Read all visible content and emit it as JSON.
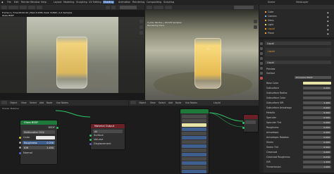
{
  "topbar": {
    "menus": [
      "File",
      "Edit",
      "Render",
      "Window",
      "Help"
    ],
    "workspaces": [
      "Layout",
      "Modeling",
      "Sculpting",
      "UV Editing",
      "Texture Paint",
      "Shading",
      "Animation",
      "Rendering",
      "Compositing",
      "Scripting"
    ],
    "scene": "Scene",
    "view_layer": "ViewLayer"
  },
  "viewport_left": {
    "info_line1": "Frame:1 | Time:00:00.00 | Mem:6.83M, Peak: 8.89M | 1/1 Samples",
    "info_line2": "Glass BSDF"
  },
  "viewport_right": {
    "info_line1": "Cycles Render | 10/128 Samples",
    "info_line2": "Rendering Done"
  },
  "node_editor_left": {
    "header": [
      "Object",
      "View",
      "Select",
      "Add",
      "Node",
      "Use Nodes"
    ],
    "material_name": "Shader Material",
    "glass_node": {
      "title": "Glass BSDF",
      "output": "BSDF",
      "distribution": "Multiscatter GGX",
      "color_label": "Color",
      "roughness_label": "Roughness",
      "roughness_value": "0.056",
      "ior_label": "IOR",
      "ior_value": "1.450",
      "normal_label": "Normal"
    },
    "output_node": {
      "title": "Material Output",
      "target": "All",
      "surface": "Surface",
      "volume": "Volume",
      "displacement": "Displacement"
    }
  },
  "node_editor_right": {
    "header": [
      "Object",
      "View",
      "Select",
      "Add",
      "Node",
      "Use Nodes"
    ],
    "material_name": "Liquid"
  },
  "outliner": {
    "items": [
      "Cube",
      "Camera",
      "Glass",
      "Light",
      "Liquid",
      "Plane"
    ]
  },
  "properties": {
    "material": "Liquid",
    "sections": [
      "Preview",
      "Surface"
    ],
    "surface_shader": "Principled BSDF",
    "rows": [
      {
        "label": "Base Color",
        "value": ""
      },
      {
        "label": "Subsurface",
        "value": "0.000"
      },
      {
        "label": "Subsurface Radius",
        "value": ""
      },
      {
        "label": "Subsurface Color",
        "value": ""
      },
      {
        "label": "Subsurface IOR",
        "value": "1.400"
      },
      {
        "label": "Subsurface Anisotropy",
        "value": "0.000"
      },
      {
        "label": "Metallic",
        "value": "0.000"
      },
      {
        "label": "Specular",
        "value": "0.500"
      },
      {
        "label": "Specular Tint",
        "value": "0.000"
      },
      {
        "label": "Roughness",
        "value": "0.000"
      },
      {
        "label": "Anisotropic",
        "value": "0.000"
      },
      {
        "label": "Anisotropic Rotation",
        "value": "0.000"
      },
      {
        "label": "Sheen",
        "value": "0.000"
      },
      {
        "label": "Sheen Tint",
        "value": "0.500"
      },
      {
        "label": "Clearcoat",
        "value": "0.000"
      },
      {
        "label": "Clearcoat Roughness",
        "value": "0.030"
      },
      {
        "label": "IOR",
        "value": "1.333"
      },
      {
        "label": "Transmission",
        "value": "1.000"
      }
    ]
  },
  "colors": {
    "accent": "#e8a531",
    "selected_tab": "#4772b3",
    "glass_header": "#1e7a39",
    "output_header": "#6b1f27",
    "socket_shader": "#33c46a",
    "socket_color": "#c7c729",
    "socket_value": "#a1a1a1",
    "socket_vector": "#6363c7"
  }
}
